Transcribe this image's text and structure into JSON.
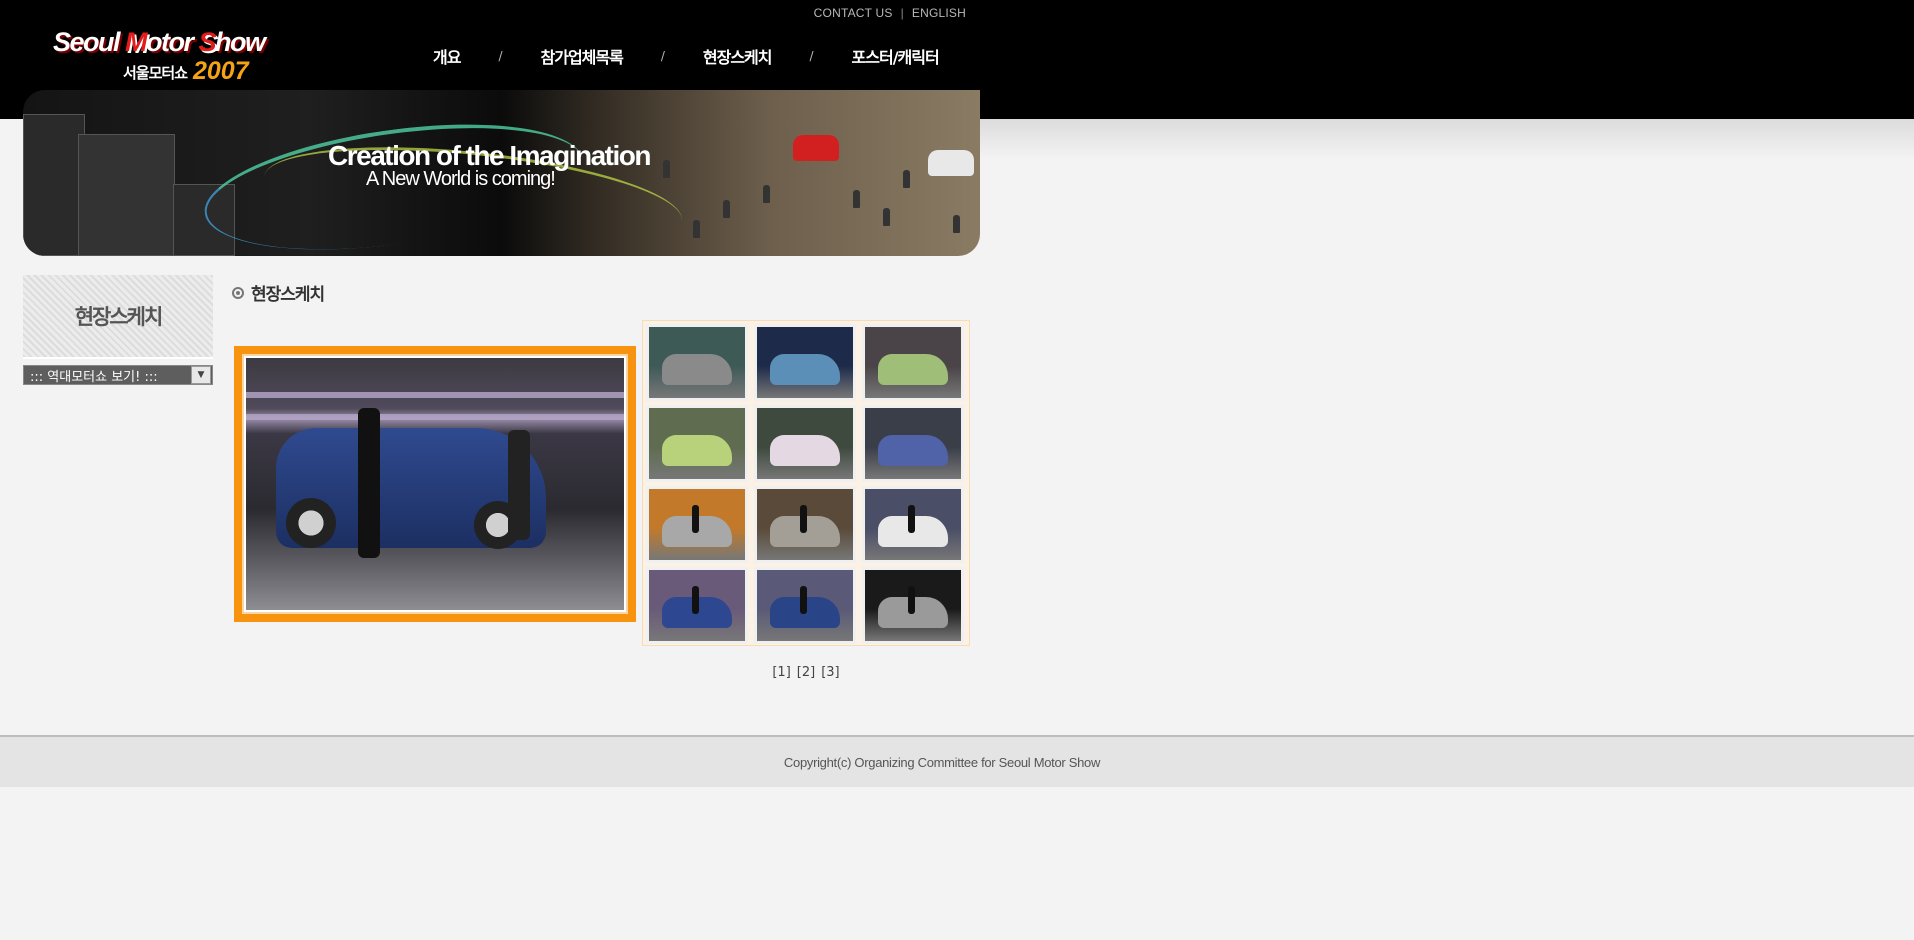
{
  "header": {
    "util_links": [
      "CONTACT US",
      "ENGLISH"
    ],
    "logo": {
      "line1_part1": "Seoul ",
      "line1_m": "M",
      "line1_part2": "otor ",
      "line1_s": "S",
      "line1_part3": "how",
      "korean": "서울모터쇼",
      "year": "2007"
    },
    "nav": [
      "개요",
      "참가업체목록",
      "현장스케치",
      "포스터/캐릭터"
    ],
    "banner": {
      "tagline_1": "Creation of the Imagination",
      "tagline_2": "A New World is coming!"
    }
  },
  "sidebar": {
    "title": "현장스케치",
    "select_value": "::: 역대모터쇼 보기! :::"
  },
  "main": {
    "title": "현장스케치",
    "featured_photo": "SUV with model",
    "thumbnails": [
      {
        "bg": "#3e5a57",
        "car": "#8a8a8a"
      },
      {
        "bg": "#1d2a4a",
        "car": "#5b8fb8"
      },
      {
        "bg": "#4a4448",
        "car": "#9fbf78"
      },
      {
        "bg": "#5f6c50",
        "car": "#b7d27a"
      },
      {
        "bg": "#3e4a3e",
        "car": "#e4d9e2"
      },
      {
        "bg": "#3a3e48",
        "car": "#5062a8"
      },
      {
        "bg": "#c27a2a",
        "car": "#a8a8a8"
      },
      {
        "bg": "#5a4a3a",
        "car": "#a39f96"
      },
      {
        "bg": "#4a4e66",
        "car": "#e8e8e8"
      },
      {
        "bg": "#6a5a7a",
        "car": "#2d4790"
      },
      {
        "bg": "#5a5a78",
        "car": "#2a4488"
      },
      {
        "bg": "#1a1a1a",
        "car": "#9a9a9a"
      }
    ],
    "pages": [
      "[1]",
      "[2]",
      "[3]"
    ]
  },
  "footer": {
    "copyright": "Copyright(c) Organizing Committee for Seoul Motor Show"
  }
}
